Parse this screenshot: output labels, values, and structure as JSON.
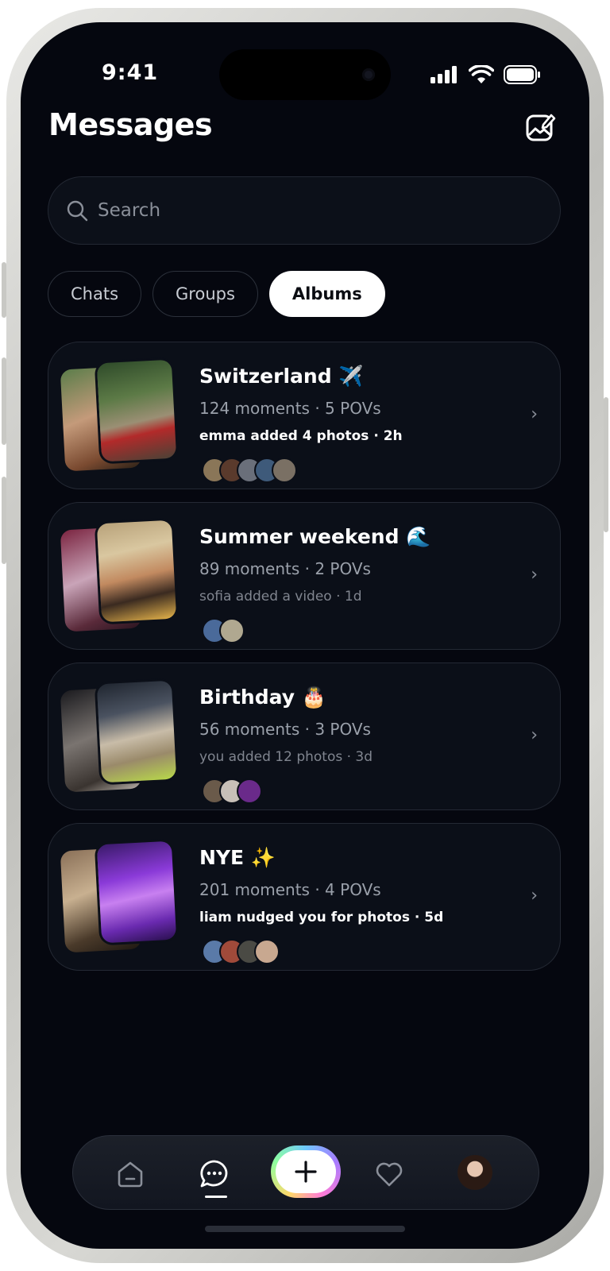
{
  "status_bar": {
    "time": "9:41"
  },
  "header": {
    "title": "Messages"
  },
  "search": {
    "placeholder": "Search"
  },
  "tabs": [
    {
      "label": "Chats",
      "active": false
    },
    {
      "label": "Groups",
      "active": false
    },
    {
      "label": "Albums",
      "active": true
    }
  ],
  "albums": [
    {
      "name": "Switzerland ✈️",
      "stats": "124 moments · 5 POVs",
      "activity": "emma added 4 photos · 2h",
      "activity_highlight": true,
      "avatar_count": 5
    },
    {
      "name": "Summer weekend 🌊",
      "stats": "89 moments · 2 POVs",
      "activity": "sofia added a video · 1d",
      "activity_highlight": false,
      "avatar_count": 2
    },
    {
      "name": "Birthday 🎂",
      "stats": "56 moments · 3 POVs",
      "activity": "you added 12 photos · 3d",
      "activity_highlight": false,
      "avatar_count": 3
    },
    {
      "name": "NYE ✨",
      "stats": "201 moments · 4 POVs",
      "activity": "liam nudged you for photos · 5d",
      "activity_highlight": true,
      "avatar_count": 4
    }
  ],
  "bottom_nav": {
    "items": [
      "home-icon",
      "messages-icon",
      "plus-icon",
      "heart-icon",
      "profile-avatar"
    ],
    "active": "messages-icon"
  },
  "colors": {
    "background": "#05070f",
    "card": "#0b0f18",
    "card_border": "#242934",
    "active_tab": "#ffffff"
  }
}
